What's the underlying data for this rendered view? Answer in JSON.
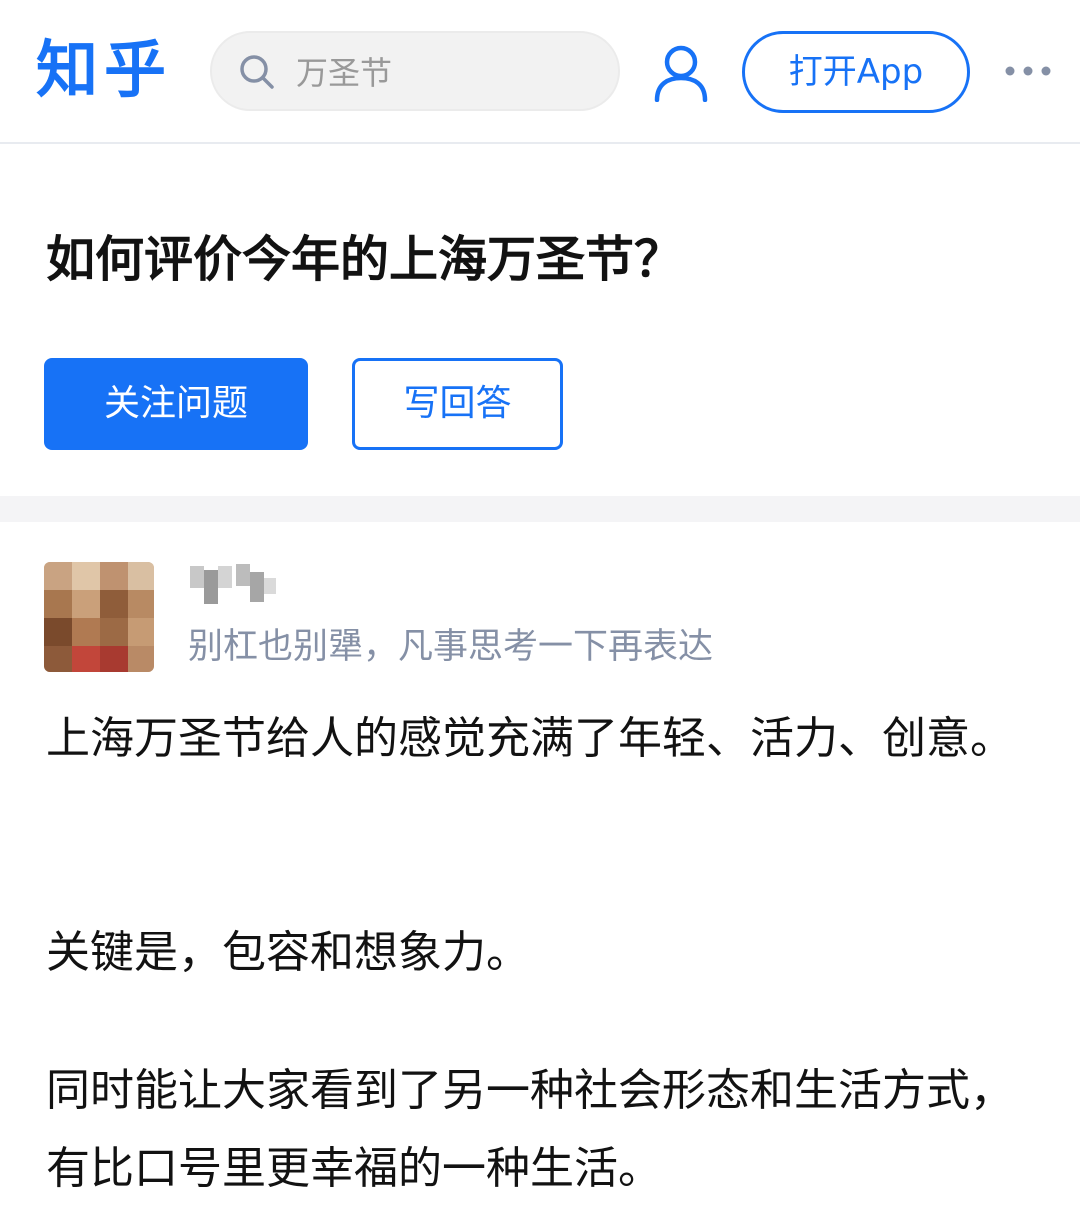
{
  "header": {
    "logo_text": "知乎",
    "search_placeholder": "万圣节",
    "open_app_label": "打开App",
    "brand_color": "#1772f6",
    "icons": [
      "search-icon",
      "user-icon",
      "more-icon"
    ]
  },
  "question": {
    "title": "如何评价今年的上海万圣节？",
    "follow_label": "关注问题",
    "answer_label": "写回答"
  },
  "answer": {
    "author_bio": "别杠也别犟，凡事思考一下再表达",
    "paragraphs": [
      "上海万圣节给人的感觉充满了年轻、活力、创意。",
      "关键是，包容和想象力。",
      "同时能让大家看到了另一种社会形态和生活方式，有比口号里更幸福的一种生活。"
    ]
  }
}
